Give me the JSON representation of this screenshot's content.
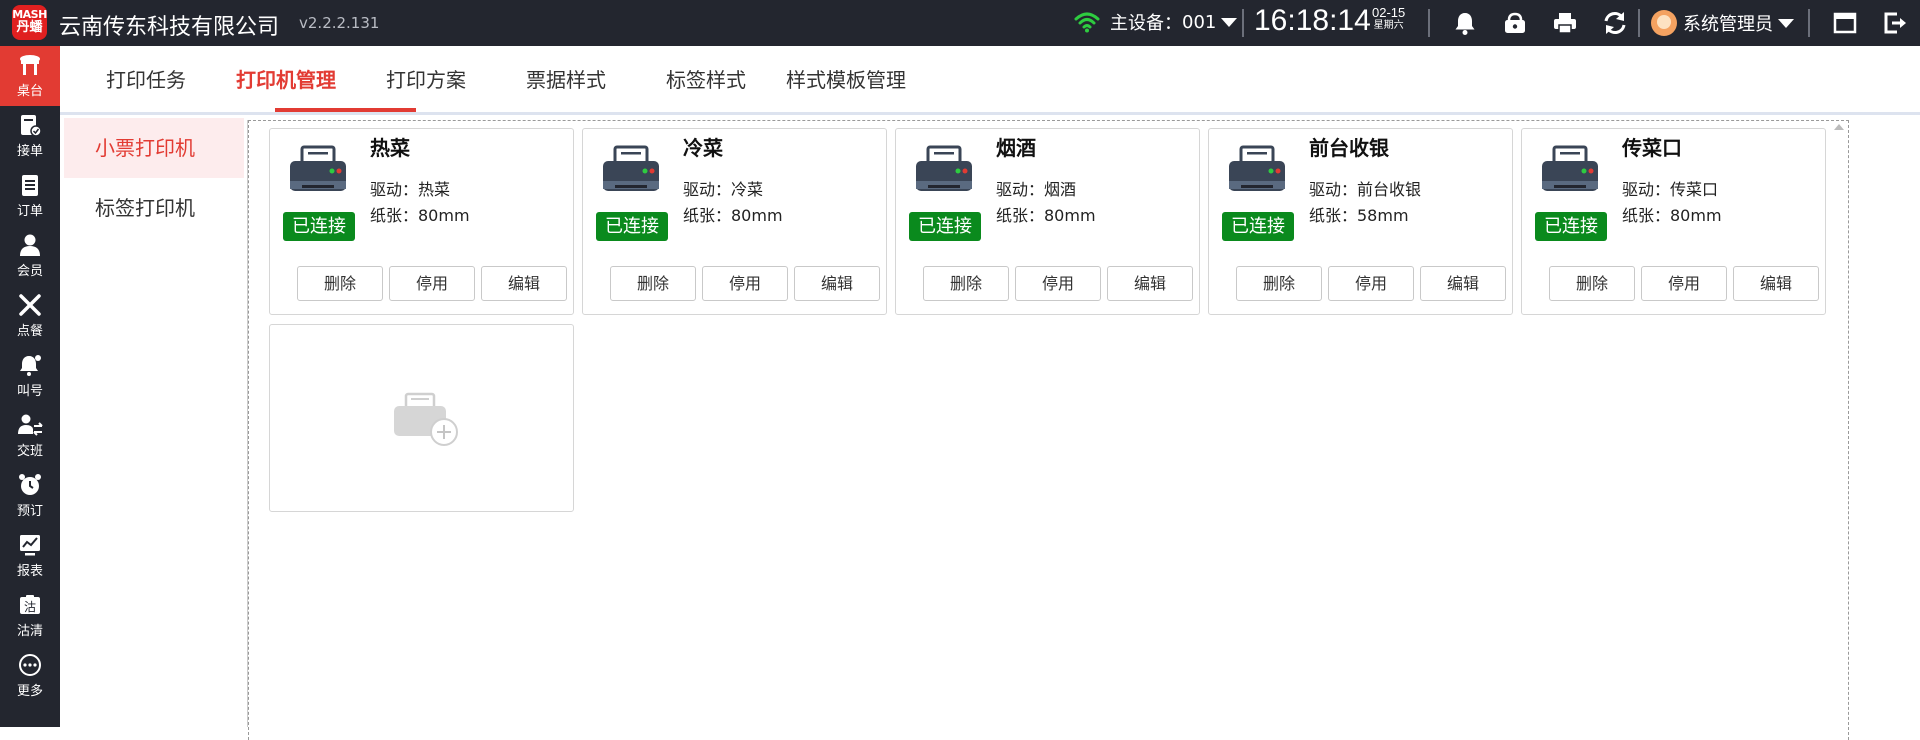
{
  "app": {
    "logo_line1": "MASH",
    "logo_line2": "丹蟠",
    "company": "云南传东科技有限公司",
    "version": "v2.2.2.131"
  },
  "header": {
    "device_label": "主设备：",
    "device_value": "001",
    "time": "16:18:14",
    "date": "02-15",
    "weekday": "星期六",
    "user": "系统管理员",
    "icons": [
      "wifi-icon",
      "bell-icon",
      "cashbox-icon",
      "printer-icon",
      "sync-icon",
      "window-icon",
      "exit-icon"
    ]
  },
  "nav": {
    "items": [
      {
        "label": "桌台",
        "icon": "table-icon",
        "active": true
      },
      {
        "label": "接单",
        "icon": "order-accept-icon"
      },
      {
        "label": "订单",
        "icon": "order-list-icon"
      },
      {
        "label": "会员",
        "icon": "member-icon"
      },
      {
        "label": "点餐",
        "icon": "fork-knife-icon"
      },
      {
        "label": "叫号",
        "icon": "call-number-icon"
      },
      {
        "label": "交班",
        "icon": "shift-handover-icon"
      },
      {
        "label": "预订",
        "icon": "alarm-clock-icon"
      },
      {
        "label": "报表",
        "icon": "report-icon"
      },
      {
        "label": "沽清",
        "icon": "sold-out-icon"
      },
      {
        "label": "更多",
        "icon": "more-icon"
      }
    ]
  },
  "tabs": [
    {
      "label": "打印任务"
    },
    {
      "label": "打印机管理",
      "active": true
    },
    {
      "label": "打印方案"
    },
    {
      "label": "票据样式"
    },
    {
      "label": "标签样式"
    },
    {
      "label": "样式模板管理"
    }
  ],
  "submenu": [
    {
      "label": "小票打印机",
      "active": true
    },
    {
      "label": "标签打印机"
    }
  ],
  "printers": [
    {
      "name": "热菜",
      "driver": "驱动：热菜",
      "paper": "纸张：80mm",
      "status": "已连接"
    },
    {
      "name": "冷菜",
      "driver": "驱动：冷菜",
      "paper": "纸张：80mm",
      "status": "已连接"
    },
    {
      "name": "烟酒",
      "driver": "驱动：烟酒",
      "paper": "纸张：80mm",
      "status": "已连接"
    },
    {
      "name": "前台收银",
      "driver": "驱动：前台收银",
      "paper": "纸张：58mm",
      "status": "已连接"
    },
    {
      "name": "传菜口",
      "driver": "驱动：传菜口",
      "paper": "纸张：80mm",
      "status": "已连接"
    }
  ],
  "card_buttons": {
    "delete": "删除",
    "disable": "停用",
    "edit": "编辑"
  },
  "colors": {
    "topbar_bg": "#23262f",
    "accent_red": "#e23b33",
    "connected_green": "#0a8a1d",
    "printer_dark": "#3a4556"
  }
}
